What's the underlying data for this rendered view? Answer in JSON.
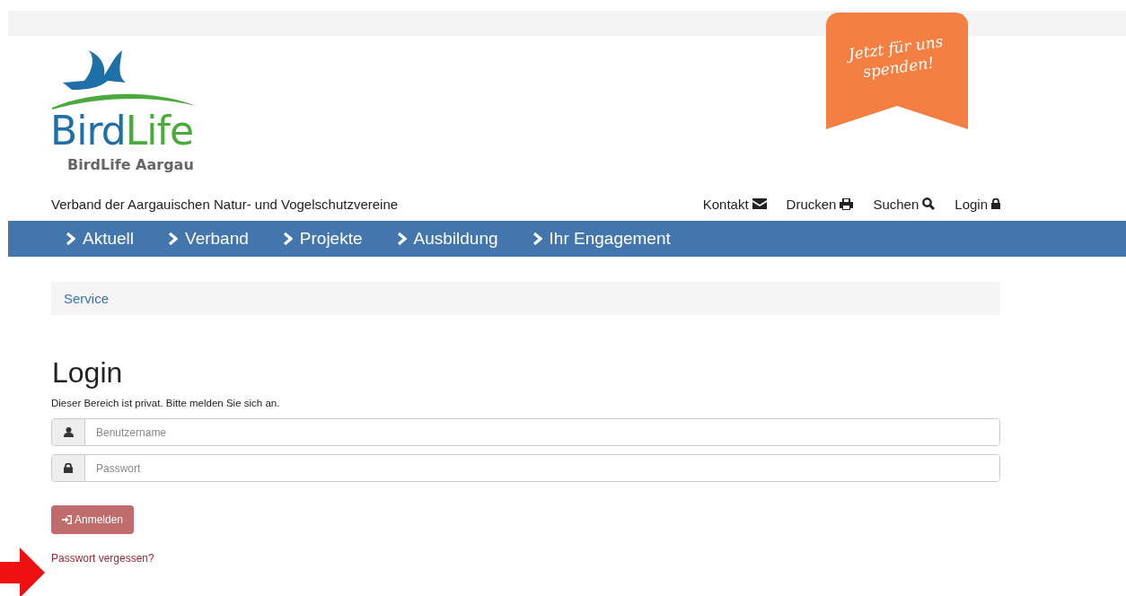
{
  "logo": {
    "wordmark_parts": [
      "Bird",
      "Life"
    ],
    "subtitle": "BirdLife Aargau"
  },
  "donate_ribbon": {
    "text": "Jetzt für uns spenden!"
  },
  "tagline": "Verband der Aargauischen Natur- und Vogelschutzvereine",
  "top_links": [
    {
      "label": "Kontakt",
      "kind": "mail"
    },
    {
      "label": "Drucken",
      "kind": "print"
    },
    {
      "label": "Suchen",
      "kind": "search"
    },
    {
      "label": "Login",
      "kind": "lock"
    }
  ],
  "nav": [
    "Aktuell",
    "Verband",
    "Projekte",
    "Ausbildung",
    "Ihr Engagement"
  ],
  "breadcrumb": "Service",
  "login": {
    "title": "Login",
    "intro": "Dieser Bereich ist privat. Bitte melden Sie sich an.",
    "fields": [
      {
        "kind": "user",
        "placeholder": "Benutzername"
      },
      {
        "kind": "lock",
        "placeholder": "Passwort"
      }
    ],
    "submit": "Anmelden",
    "forgot_link": "Passwort vergessen?"
  }
}
